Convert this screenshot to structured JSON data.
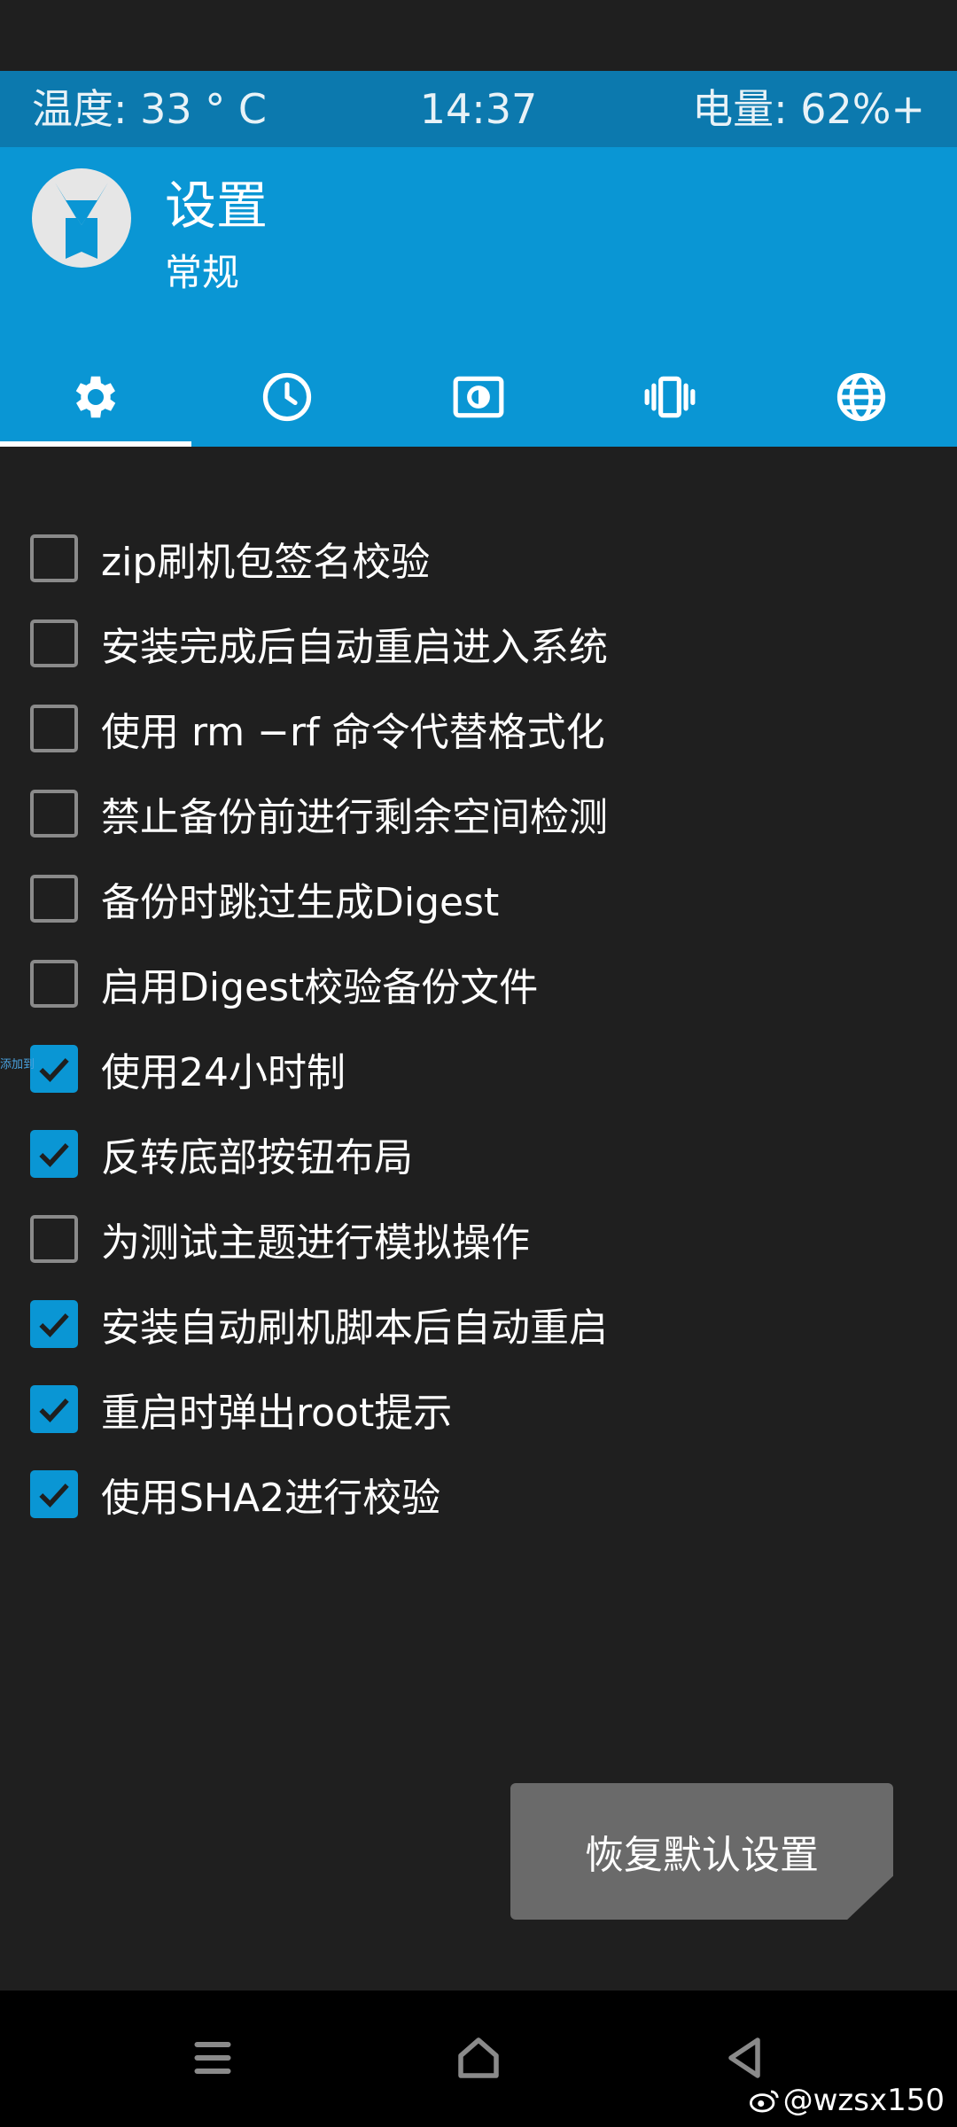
{
  "statusbar": {
    "temperature": "温度: 33 ° C",
    "time": "14:37",
    "battery": "电量: 62%+"
  },
  "header": {
    "title": "设置",
    "subtitle": "常规"
  },
  "tabs": [
    {
      "icon": "gear-icon",
      "active": true
    },
    {
      "icon": "clock-icon",
      "active": false
    },
    {
      "icon": "brightness-icon",
      "active": false
    },
    {
      "icon": "vibration-icon",
      "active": false
    },
    {
      "icon": "globe-icon",
      "active": false
    }
  ],
  "options": [
    {
      "label": "zip刷机包签名校验",
      "checked": false
    },
    {
      "label": "安装完成后自动重启进入系统",
      "checked": false
    },
    {
      "label": "使用 rm −rf 命令代替格式化",
      "checked": false
    },
    {
      "label": "禁止备份前进行剩余空间检测",
      "checked": false
    },
    {
      "label": "备份时跳过生成Digest",
      "checked": false
    },
    {
      "label": "启用Digest校验备份文件",
      "checked": false
    },
    {
      "label": "使用24小时制",
      "checked": true
    },
    {
      "label": "反转底部按钮布局",
      "checked": true
    },
    {
      "label": "为测试主题进行模拟操作",
      "checked": false
    },
    {
      "label": "安装自动刷机脚本后自动重启",
      "checked": true
    },
    {
      "label": "重启时弹出root提示",
      "checked": true
    },
    {
      "label": "使用SHA2进行校验",
      "checked": true
    }
  ],
  "restore_button": "恢复默认设置",
  "watermark_small": "添加到",
  "watermark": "@wzsx150",
  "colors": {
    "accent": "#0a96d4",
    "statusbar": "#0c79ae",
    "background": "#1f1f1f",
    "button": "#6a6a6a"
  }
}
